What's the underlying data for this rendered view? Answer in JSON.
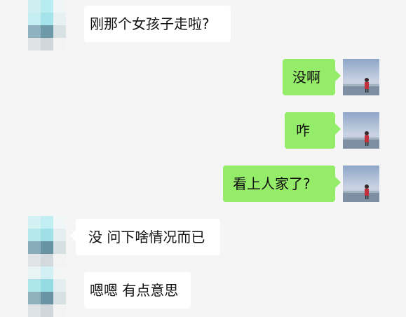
{
  "messages": [
    {
      "side": "left",
      "text": "刚那个女孩子走啦?"
    },
    {
      "side": "right",
      "text": "没啊"
    },
    {
      "side": "right",
      "text": "咋"
    },
    {
      "side": "right",
      "text": "看上人家了?"
    },
    {
      "side": "left",
      "text": "没 问下啥情况而已"
    },
    {
      "side": "left",
      "text": "嗯嗯 有点意思"
    }
  ],
  "colors": {
    "background": "#f5f5f5",
    "sent_bubble": "#95ec69",
    "received_bubble": "#ffffff"
  }
}
